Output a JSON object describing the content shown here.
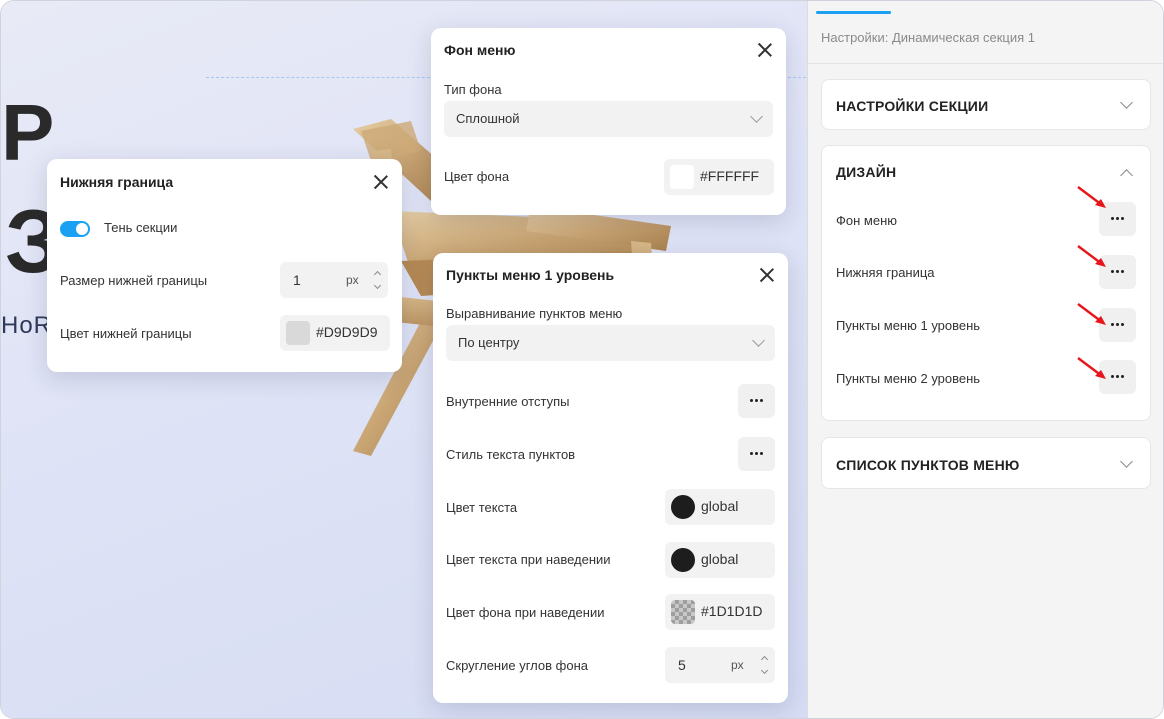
{
  "canvas": {
    "big_char_1": "Р",
    "big_char_2": "З",
    "hor_text": "HoR"
  },
  "popup_bottom_border": {
    "title": "Нижняя граница",
    "shadow_toggle_label": "Тень секции",
    "size_label": "Размер нижней границы",
    "size_value": "1",
    "size_unit": "px",
    "color_label": "Цвет нижней границы",
    "color_value": "#D9D9D9",
    "color_swatch": "#D9D9D9",
    "toggle_color": "#1AA1F2"
  },
  "popup_menu_bg": {
    "title": "Фон меню",
    "bg_type_label": "Тип фона",
    "bg_type_value": "Сплошной",
    "bg_color_label": "Цвет фона",
    "bg_color_value": "#FFFFFF",
    "bg_color_swatch": "#FFFFFF"
  },
  "popup_menu_items": {
    "title": "Пункты меню 1 уровень",
    "align_label": "Выравнивание пунктов меню",
    "align_value": "По центру",
    "padding_label": "Внутренние отступы",
    "text_style_label": "Стиль текста пунктов",
    "text_color_label": "Цвет текста",
    "text_color_value": "global",
    "text_color_swatch": "#1D1D1D",
    "hover_text_color_label": "Цвет текста при наведении",
    "hover_text_color_value": "global",
    "hover_text_color_swatch": "#1D1D1D",
    "hover_bg_color_label": "Цвет фона при наведении",
    "hover_bg_color_value": "#1D1D1D",
    "radius_label": "Скругление углов фона",
    "radius_value": "5",
    "radius_unit": "px"
  },
  "panel": {
    "breadcrumb": "Настройки: Динамическая секция 1",
    "accent_color": "#1AA1F2",
    "sections": {
      "section_settings": "НАСТРОЙКИ СЕКЦИИ",
      "design": "ДИЗАЙН",
      "menu_items_list": "СПИСОК ПУНКТОВ МЕНЮ"
    },
    "design_rows": [
      {
        "label": "Фон меню"
      },
      {
        "label": "Нижняя граница"
      },
      {
        "label": "Пункты меню 1 уровень"
      },
      {
        "label": "Пункты меню 2 уровень"
      }
    ],
    "arrow_color": "#E8141B"
  }
}
